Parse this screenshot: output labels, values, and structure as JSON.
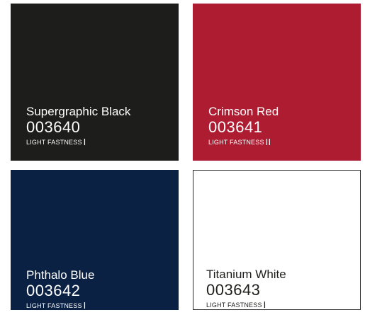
{
  "swatches": [
    {
      "name": "Supergraphic Black",
      "code": "003640",
      "light_fastness_label": "LIGHT FASTNESS",
      "light_fastness_value": "I",
      "color": "#1d1d1b",
      "text_color": "#ffffff"
    },
    {
      "name": "Crimson Red",
      "code": "003641",
      "light_fastness_label": "LIGHT FASTNESS",
      "light_fastness_value": "II",
      "color": "#ae1c32",
      "text_color": "#ffffff"
    },
    {
      "name": "Phthalo Blue",
      "code": "003642",
      "light_fastness_label": "LIGHT FASTNESS",
      "light_fastness_value": "I",
      "color": "#0b2144",
      "text_color": "#ffffff"
    },
    {
      "name": "Titanium White",
      "code": "003643",
      "light_fastness_label": "LIGHT FASTNESS",
      "light_fastness_value": "I",
      "color": "#ffffff",
      "text_color": "#1d1d1b"
    }
  ]
}
